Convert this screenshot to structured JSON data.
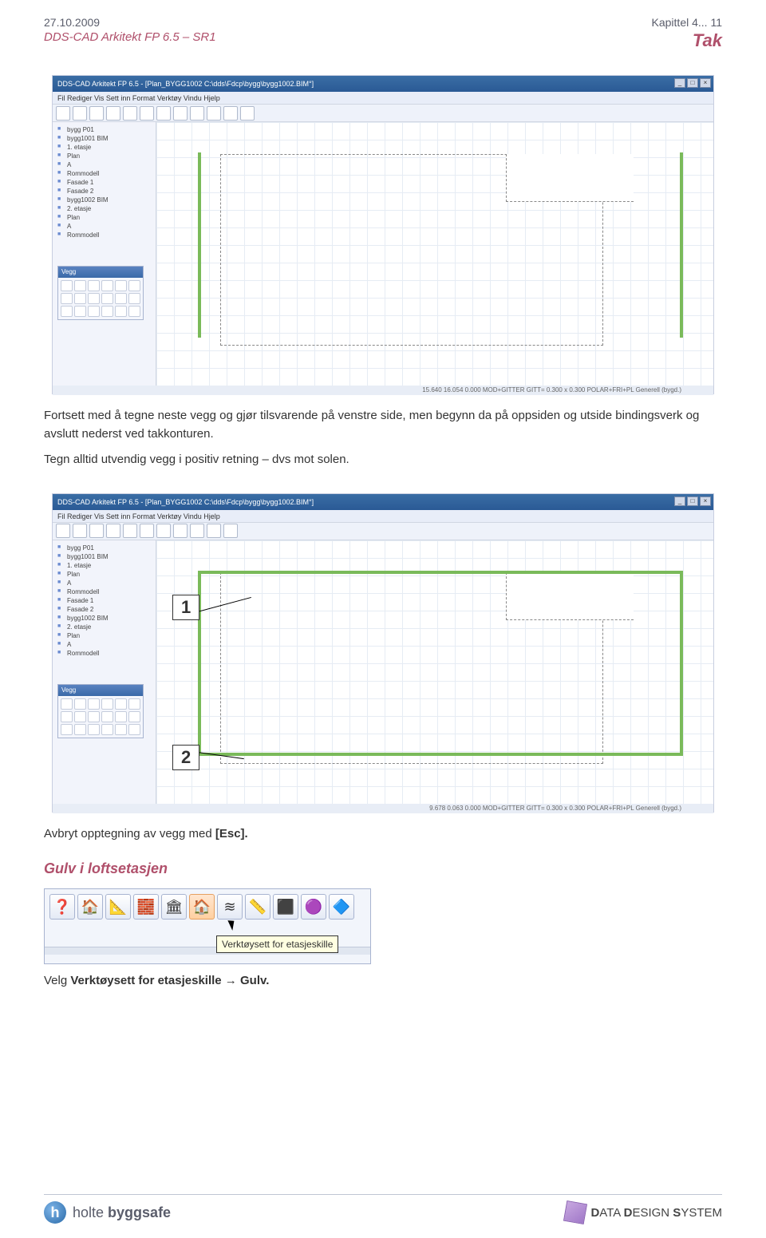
{
  "header": {
    "date": "27.10.2009",
    "chapter": "Kapittel 4...",
    "page": "11",
    "product": "DDS-CAD Arkitekt  FP  6.5 – SR1",
    "section": "Tak"
  },
  "appwindow": {
    "title": "DDS-CAD Arkitekt FP 6.5 - [Plan_BYGG1002  C:\\dds\\Fdcp\\bygg\\bygg1002.BIM°]",
    "menubar": "Fil   Rediger   Vis   Sett inn   Format   Verktøy   Vindu   Hjelp",
    "statusbar": "15.640    16.054    0.000    MOD+GITTER    GITT= 0.300 x 0.300    POLAR+FRI+PL    Generell (bygd.)",
    "statusbar2": "9.678    0.063    0.000    MOD+GITTER    GITT= 0.300 x 0.300    POLAR+FRI+PL    Generell (bygd.)"
  },
  "tree": {
    "items": [
      "bygg P01",
      "bygg1001 BIM",
      "1. etasje",
      "Plan",
      "A",
      "Rommodell",
      "Fasade 1",
      "Fasade 2",
      "bygg1002 BIM",
      "2. etasje",
      "Plan",
      "A",
      "Rommodell"
    ]
  },
  "palette": {
    "title": "Vegg"
  },
  "body": {
    "p1": "Fortsett med å tegne neste vegg og gjør tilsvarende på venstre side, men begynn da på oppsiden og utside bindingsverk og avslutt nederst ved takkonturen.",
    "p2": "Tegn alltid utvendig vegg i positiv retning – dvs mot solen.",
    "p3_a": "Avbryt opptegning av vegg med ",
    "p3_b": "[Esc].",
    "section_title": "Gulv i loftsetasjen",
    "p4_a": "Velg ",
    "p4_b": "Verktøysett for etasjeskille",
    "p4_c": " → ",
    "p4_d": "Gulv."
  },
  "labels": {
    "one": "1",
    "two": "2"
  },
  "tooltip": "Verktøysett for etasjeskille",
  "bigtoolbar": {
    "icons": [
      "❓",
      "🏠",
      "📐",
      "🧱",
      "🏛",
      "🏠",
      "≋",
      "📏",
      "⬛",
      "🟣",
      "🔷"
    ]
  },
  "footer": {
    "left_a": "holte ",
    "left_b": "byggsafe",
    "right_a": "D",
    "right_b": "ATA ",
    "right_c": "D",
    "right_d": "ESIGN ",
    "right_e": "S",
    "right_f": "YSTEM"
  }
}
